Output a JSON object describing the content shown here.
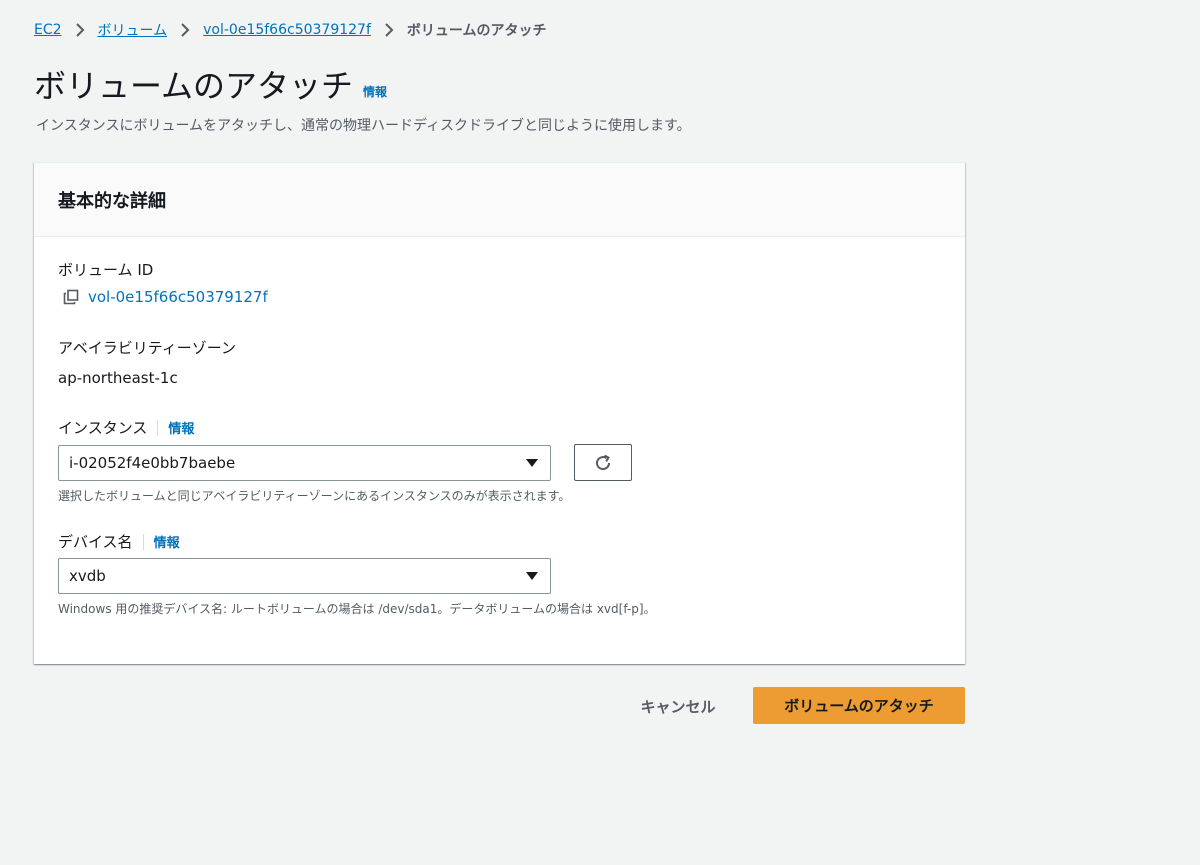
{
  "breadcrumb": {
    "items": [
      "EC2",
      "ボリューム",
      "vol-0e15f66c50379127f"
    ],
    "current": "ボリュームのアタッチ"
  },
  "page": {
    "title": "ボリュームのアタッチ",
    "info_label": "情報",
    "description": "インスタンスにボリュームをアタッチし、通常の物理ハードディスクドライブと同じように使用します。"
  },
  "panel": {
    "title": "基本的な詳細",
    "volume_id": {
      "label": "ボリューム ID",
      "value": "vol-0e15f66c50379127f",
      "icon": "copy-icon"
    },
    "availability_zone": {
      "label": "アベイラビリティーゾーン",
      "value": "ap-northeast-1c"
    },
    "instance": {
      "label": "インスタンス",
      "info_label": "情報",
      "selected": "i-02052f4e0bb7baebe",
      "hint": "選択したボリュームと同じアベイラビリティーゾーンにあるインスタンスのみが表示されます。",
      "refresh_icon": "refresh-icon"
    },
    "device_name": {
      "label": "デバイス名",
      "info_label": "情報",
      "selected": "xvdb",
      "hint": "Windows 用の推奨デバイス名: ルートボリュームの場合は /dev/sda1。データボリュームの場合は xvd[f-p]。"
    }
  },
  "actions": {
    "cancel_label": "キャンセル",
    "attach_label": "ボリュームのアタッチ"
  },
  "colors": {
    "background": "#f2f3f3",
    "link": "#0073bb",
    "primary_button": "#ec9c33",
    "panel_header": "#fafafa"
  }
}
